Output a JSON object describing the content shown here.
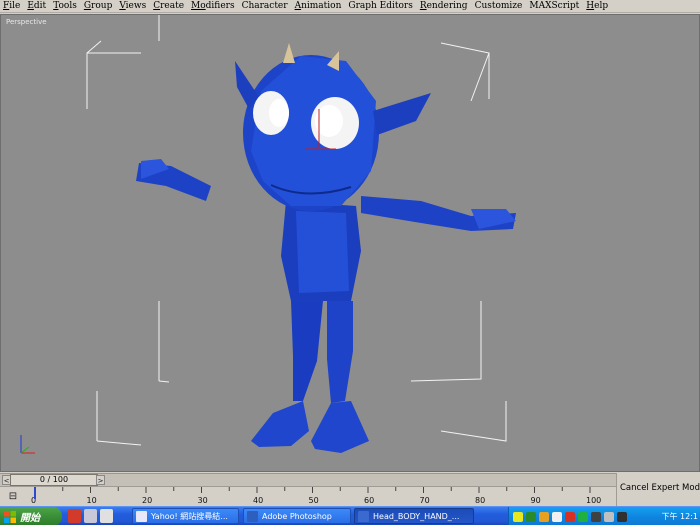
{
  "menubar": {
    "items": [
      {
        "ul": "F",
        "rest": "ile"
      },
      {
        "ul": "E",
        "rest": "dit"
      },
      {
        "ul": "T",
        "rest": "ools"
      },
      {
        "ul": "G",
        "rest": "roup"
      },
      {
        "ul": "V",
        "rest": "iews"
      },
      {
        "ul": "C",
        "rest": "reate"
      },
      {
        "ul": "Mo",
        "rest": "difiers"
      },
      {
        "ul": "",
        "rest": "Character"
      },
      {
        "ul": "A",
        "rest": "nimation"
      },
      {
        "ul": "",
        "rest": "Graph Editors"
      },
      {
        "ul": "R",
        "rest": "endering"
      },
      {
        "ul": "",
        "rest": "Customize"
      },
      {
        "ul": "",
        "rest": "MAXScript"
      },
      {
        "ul": "H",
        "rest": "elp"
      }
    ]
  },
  "viewport": {
    "label": "Perspective",
    "background": "#8d8d8d",
    "character_color": "#1a3fc8"
  },
  "timeslider": {
    "frame_label": "0 / 100",
    "prev_glyph": "<",
    "next_glyph": ">"
  },
  "trackbar": {
    "ticks": [
      "0",
      "10",
      "20",
      "30",
      "40",
      "50",
      "60",
      "70",
      "80",
      "90",
      "100"
    ]
  },
  "status": {
    "cancel_expert": "Cancel Expert Mode"
  },
  "taskbar": {
    "start_label": "開始",
    "tasks": [
      {
        "label": "Yahoo! 網站搜尋結...",
        "icon_color": "#e8e8f8"
      },
      {
        "label": "Adobe Photoshop",
        "icon_color": "#2d5fbf"
      },
      {
        "label": "Head_BODY_HAND_...",
        "icon_color": "#3a6ad0"
      }
    ],
    "clock": "下午 12:1"
  }
}
